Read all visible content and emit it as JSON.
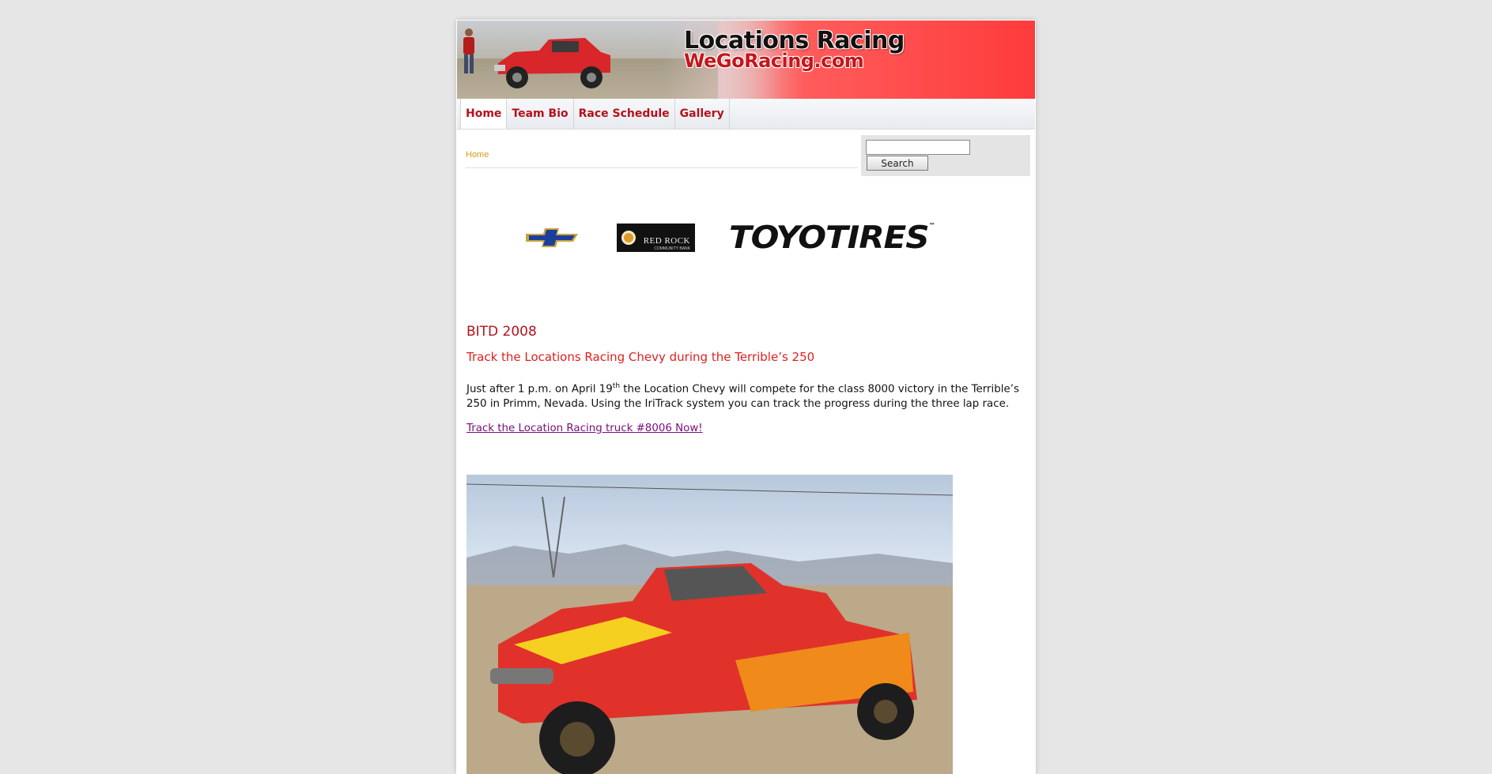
{
  "site": {
    "title": "Locations Racing",
    "subtitle": "WeGoRacing.com"
  },
  "nav": {
    "items": [
      {
        "label": "Home"
      },
      {
        "label": "Team Bio"
      },
      {
        "label": "Race Schedule"
      },
      {
        "label": "Gallery"
      }
    ]
  },
  "breadcrumb": "Home",
  "search": {
    "value": "",
    "button_label": "Search"
  },
  "sponsors": {
    "chevy": "chevrolet-bowtie-logo",
    "redrock_line1": "RED ROCK",
    "redrock_line2": "COMMUNITY BANK",
    "toyo": "TOYOTIRES",
    "toyo_tm": "™"
  },
  "article": {
    "heading": "BITD 2008",
    "subheading": "Track the Locations Racing Chevy during the Terrible’s 250",
    "body_part1": "Just after 1 p.m. on April 19",
    "body_sup": "th",
    "body_part2": " the Location Chevy will compete for the class 8000 victory in the Terrible’s 250 in Primm, Nevada.  Using the IriTrack system you can track the progress during the three lap race.",
    "link_text": "Track the Location Racing truck #8006 Now!"
  },
  "colors": {
    "accent_red": "#b3121c",
    "link_purple": "#7a0d7a",
    "breadcrumb_gold": "#d49b1a"
  }
}
